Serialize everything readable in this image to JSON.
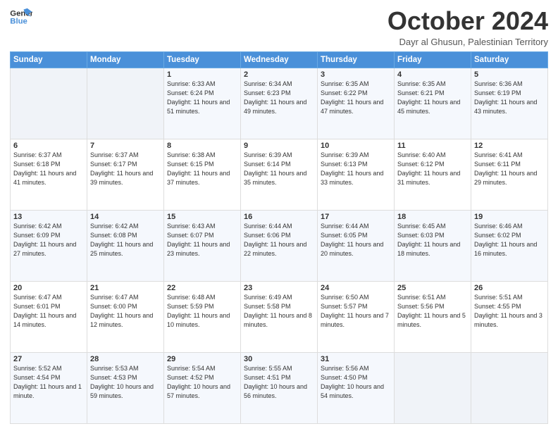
{
  "header": {
    "logo_line1": "General",
    "logo_line2": "Blue",
    "month": "October 2024",
    "location": "Dayr al Ghusun, Palestinian Territory"
  },
  "days_of_week": [
    "Sunday",
    "Monday",
    "Tuesday",
    "Wednesday",
    "Thursday",
    "Friday",
    "Saturday"
  ],
  "weeks": [
    [
      {
        "day": "",
        "info": ""
      },
      {
        "day": "",
        "info": ""
      },
      {
        "day": "1",
        "info": "Sunrise: 6:33 AM\nSunset: 6:24 PM\nDaylight: 11 hours and 51 minutes."
      },
      {
        "day": "2",
        "info": "Sunrise: 6:34 AM\nSunset: 6:23 PM\nDaylight: 11 hours and 49 minutes."
      },
      {
        "day": "3",
        "info": "Sunrise: 6:35 AM\nSunset: 6:22 PM\nDaylight: 11 hours and 47 minutes."
      },
      {
        "day": "4",
        "info": "Sunrise: 6:35 AM\nSunset: 6:21 PM\nDaylight: 11 hours and 45 minutes."
      },
      {
        "day": "5",
        "info": "Sunrise: 6:36 AM\nSunset: 6:19 PM\nDaylight: 11 hours and 43 minutes."
      }
    ],
    [
      {
        "day": "6",
        "info": "Sunrise: 6:37 AM\nSunset: 6:18 PM\nDaylight: 11 hours and 41 minutes."
      },
      {
        "day": "7",
        "info": "Sunrise: 6:37 AM\nSunset: 6:17 PM\nDaylight: 11 hours and 39 minutes."
      },
      {
        "day": "8",
        "info": "Sunrise: 6:38 AM\nSunset: 6:15 PM\nDaylight: 11 hours and 37 minutes."
      },
      {
        "day": "9",
        "info": "Sunrise: 6:39 AM\nSunset: 6:14 PM\nDaylight: 11 hours and 35 minutes."
      },
      {
        "day": "10",
        "info": "Sunrise: 6:39 AM\nSunset: 6:13 PM\nDaylight: 11 hours and 33 minutes."
      },
      {
        "day": "11",
        "info": "Sunrise: 6:40 AM\nSunset: 6:12 PM\nDaylight: 11 hours and 31 minutes."
      },
      {
        "day": "12",
        "info": "Sunrise: 6:41 AM\nSunset: 6:11 PM\nDaylight: 11 hours and 29 minutes."
      }
    ],
    [
      {
        "day": "13",
        "info": "Sunrise: 6:42 AM\nSunset: 6:09 PM\nDaylight: 11 hours and 27 minutes."
      },
      {
        "day": "14",
        "info": "Sunrise: 6:42 AM\nSunset: 6:08 PM\nDaylight: 11 hours and 25 minutes."
      },
      {
        "day": "15",
        "info": "Sunrise: 6:43 AM\nSunset: 6:07 PM\nDaylight: 11 hours and 23 minutes."
      },
      {
        "day": "16",
        "info": "Sunrise: 6:44 AM\nSunset: 6:06 PM\nDaylight: 11 hours and 22 minutes."
      },
      {
        "day": "17",
        "info": "Sunrise: 6:44 AM\nSunset: 6:05 PM\nDaylight: 11 hours and 20 minutes."
      },
      {
        "day": "18",
        "info": "Sunrise: 6:45 AM\nSunset: 6:03 PM\nDaylight: 11 hours and 18 minutes."
      },
      {
        "day": "19",
        "info": "Sunrise: 6:46 AM\nSunset: 6:02 PM\nDaylight: 11 hours and 16 minutes."
      }
    ],
    [
      {
        "day": "20",
        "info": "Sunrise: 6:47 AM\nSunset: 6:01 PM\nDaylight: 11 hours and 14 minutes."
      },
      {
        "day": "21",
        "info": "Sunrise: 6:47 AM\nSunset: 6:00 PM\nDaylight: 11 hours and 12 minutes."
      },
      {
        "day": "22",
        "info": "Sunrise: 6:48 AM\nSunset: 5:59 PM\nDaylight: 11 hours and 10 minutes."
      },
      {
        "day": "23",
        "info": "Sunrise: 6:49 AM\nSunset: 5:58 PM\nDaylight: 11 hours and 8 minutes."
      },
      {
        "day": "24",
        "info": "Sunrise: 6:50 AM\nSunset: 5:57 PM\nDaylight: 11 hours and 7 minutes."
      },
      {
        "day": "25",
        "info": "Sunrise: 6:51 AM\nSunset: 5:56 PM\nDaylight: 11 hours and 5 minutes."
      },
      {
        "day": "26",
        "info": "Sunrise: 5:51 AM\nSunset: 4:55 PM\nDaylight: 11 hours and 3 minutes."
      }
    ],
    [
      {
        "day": "27",
        "info": "Sunrise: 5:52 AM\nSunset: 4:54 PM\nDaylight: 11 hours and 1 minute."
      },
      {
        "day": "28",
        "info": "Sunrise: 5:53 AM\nSunset: 4:53 PM\nDaylight: 10 hours and 59 minutes."
      },
      {
        "day": "29",
        "info": "Sunrise: 5:54 AM\nSunset: 4:52 PM\nDaylight: 10 hours and 57 minutes."
      },
      {
        "day": "30",
        "info": "Sunrise: 5:55 AM\nSunset: 4:51 PM\nDaylight: 10 hours and 56 minutes."
      },
      {
        "day": "31",
        "info": "Sunrise: 5:56 AM\nSunset: 4:50 PM\nDaylight: 10 hours and 54 minutes."
      },
      {
        "day": "",
        "info": ""
      },
      {
        "day": "",
        "info": ""
      }
    ]
  ]
}
